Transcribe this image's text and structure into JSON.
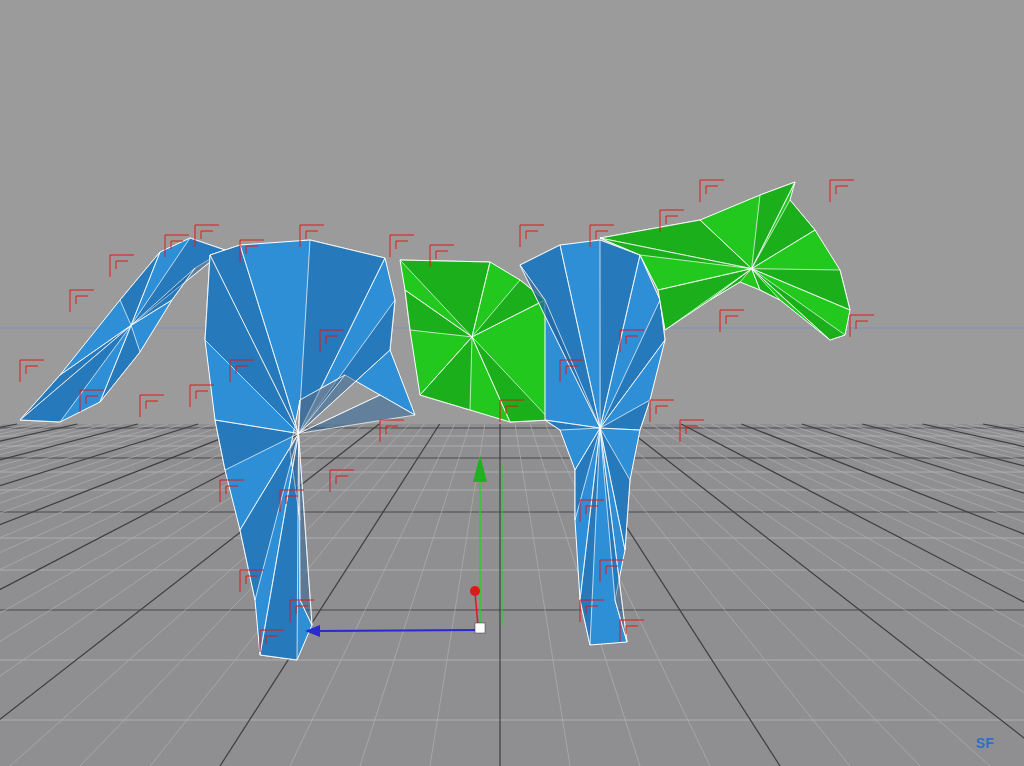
{
  "viewport": {
    "mesh_parts": [
      {
        "kind": "tail",
        "selected": false
      },
      {
        "kind": "hindquarters",
        "selected": false
      },
      {
        "kind": "midsection",
        "selected": true
      },
      {
        "kind": "forequarters",
        "selected": false
      },
      {
        "kind": "head",
        "selected": true
      }
    ],
    "corner_label": "SF"
  }
}
